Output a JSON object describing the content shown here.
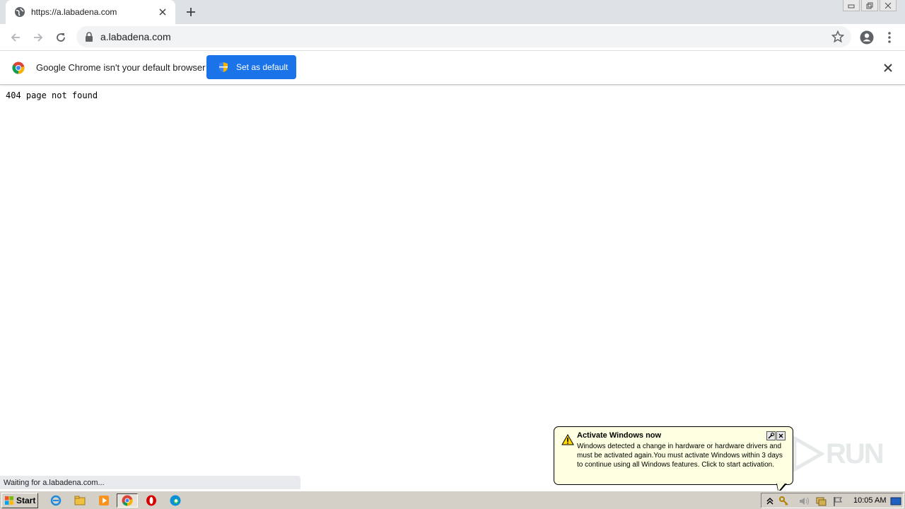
{
  "browser": {
    "tab": {
      "title": "https://a.labadena.com"
    },
    "address_bar": {
      "url": "a.labadena.com"
    }
  },
  "infobar": {
    "message": "Google Chrome isn't your default browser",
    "button_label": "Set as default"
  },
  "page": {
    "body_text": "404 page not found"
  },
  "status": {
    "text": "Waiting for a.labadena.com..."
  },
  "balloon": {
    "title": "Activate Windows now",
    "body": "Windows detected a change in hardware or hardware drivers and must be activated again.You must activate Windows within 3 days to continue using all Windows features. Click to start activation."
  },
  "watermark": {
    "text": "RUN"
  },
  "taskbar": {
    "start_label": "Start",
    "clock": "10:05 AM"
  },
  "colors": {
    "accent": "#1a73e8",
    "tabstrip": "#dee1e6",
    "balloon_bg": "#ffffe1",
    "taskbar": "#d4d0c8"
  },
  "icons": [
    "globe-icon",
    "close-icon",
    "plus-icon",
    "back-icon",
    "forward-icon",
    "reload-icon",
    "lock-icon",
    "star-icon",
    "account-icon",
    "menu-icon",
    "chrome-logo-icon",
    "shield-icon",
    "warning-icon",
    "windows-flag-icon",
    "ie-icon",
    "explorer-icon",
    "media-player-icon",
    "opera-icon",
    "edge-icon"
  ]
}
